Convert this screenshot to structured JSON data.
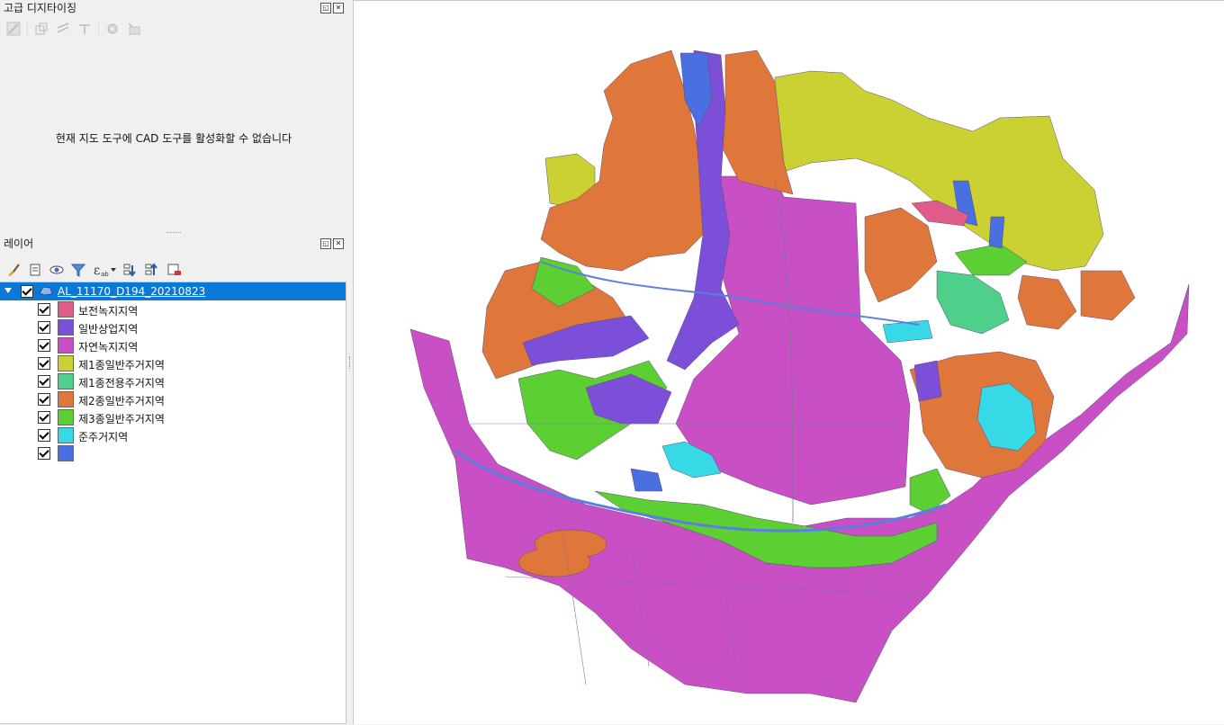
{
  "digitizing_panel": {
    "title": "고급 디지타이징",
    "message": "현재 지도 도구에 CAD 도구를 활성화할 수 없습니다"
  },
  "layers_panel": {
    "title": "레이어",
    "layer": {
      "name": "AL_11170_D194_20210823",
      "checked": true,
      "classes": [
        {
          "label": "보전녹지지역",
          "color": "#e05c8a",
          "checked": true
        },
        {
          "label": "일반상업지역",
          "color": "#7b4fd8",
          "checked": true
        },
        {
          "label": "자연녹지지역",
          "color": "#c84fc4",
          "checked": true
        },
        {
          "label": "제1종일반주거지역",
          "color": "#cbd132",
          "checked": true
        },
        {
          "label": "제1종전용주거지역",
          "color": "#4ecf8a",
          "checked": true
        },
        {
          "label": "제2종일반주거지역",
          "color": "#e0773a",
          "checked": true
        },
        {
          "label": "제3종일반주거지역",
          "color": "#5ccf32",
          "checked": true
        },
        {
          "label": "준주거지역",
          "color": "#38d9e6",
          "checked": true
        },
        {
          "label": "",
          "color": "#4a6fe0",
          "checked": true
        }
      ]
    }
  },
  "toolbar_icons": {
    "digitizing": [
      "cad-toggle-icon",
      "construction-icon",
      "parallel-icon",
      "perpendicular-icon",
      "settings-icon",
      "floater-icon"
    ],
    "layers": [
      "style-brush-icon",
      "add-group-icon",
      "visibility-eye-icon",
      "filter-icon",
      "expression-filter-icon",
      "expand-all-icon",
      "collapse-all-icon",
      "remove-layer-icon"
    ]
  }
}
